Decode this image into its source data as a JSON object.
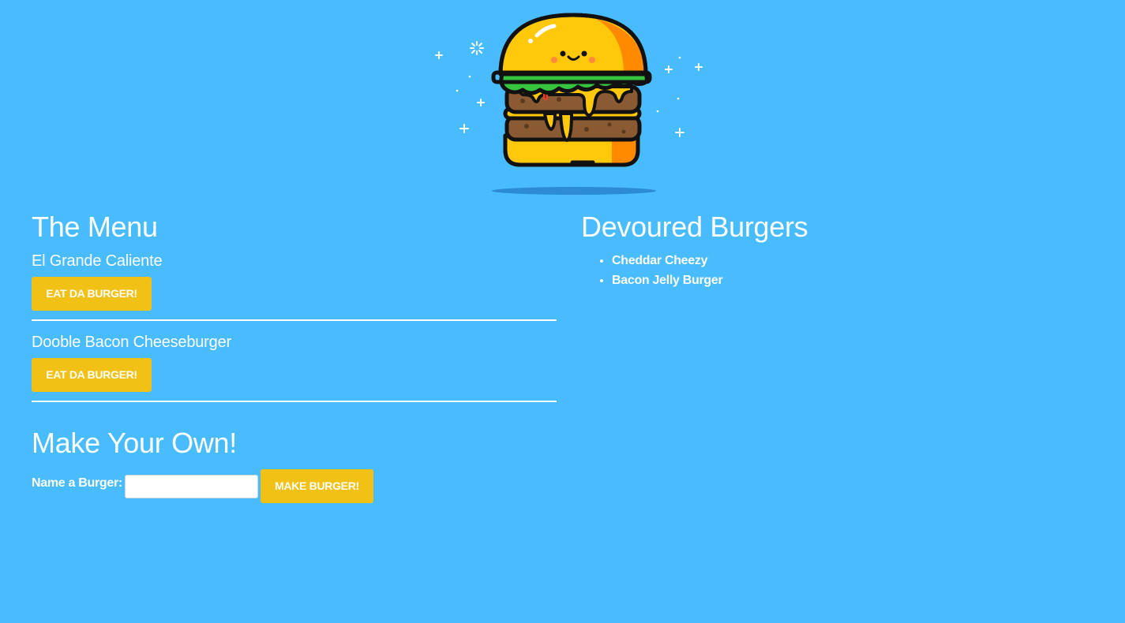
{
  "menu": {
    "title": "The Menu",
    "items": [
      {
        "name": "El Grande Caliente",
        "button_label": "EAT DA BURGER!"
      },
      {
        "name": "Dooble Bacon Cheeseburger",
        "button_label": "EAT DA BURGER!"
      }
    ]
  },
  "make_own": {
    "title": "Make Your Own!",
    "field_label": "Name a Burger:",
    "field_value": "",
    "field_placeholder": "",
    "button_label": "MAKE BURGER!"
  },
  "devoured": {
    "title": "Devoured Burgers",
    "items": [
      "Cheddar Cheezy",
      "Bacon Jelly Burger"
    ]
  },
  "colors": {
    "background": "#48BCFD",
    "button": "#F2C115",
    "text": "#FFFFFF"
  },
  "icons": {
    "hero": "burger-mascot-icon"
  }
}
